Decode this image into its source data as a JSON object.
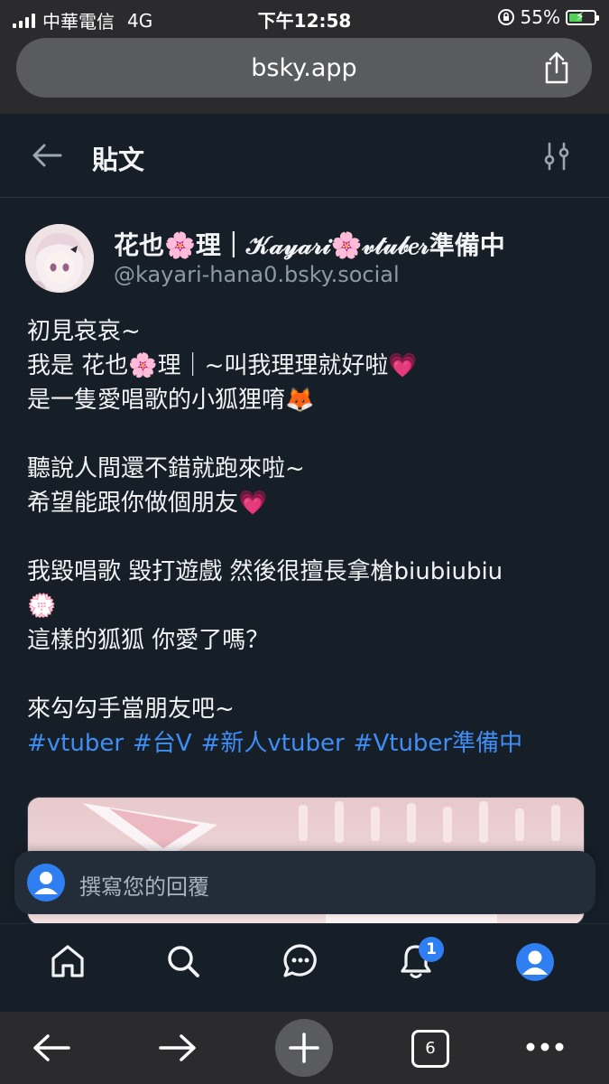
{
  "status_bar": {
    "carrier": "中華電信",
    "network": "4G",
    "time": "下午12:58",
    "battery": "55%",
    "battery_level": 0.55
  },
  "browser": {
    "url": "bsky.app",
    "tab_count": "6"
  },
  "header": {
    "title": "貼文"
  },
  "post": {
    "display_name": "花也🌸理｜𝒦𝒶𝓎𝒶𝓇𝒾🌸𝓋𝓉𝓊𝒷𝑒𝓇準備中",
    "handle": "@kayari-hana0.bsky.social",
    "lines": [
      "初見哀哀~",
      "我是 花也🌸理｜~叫我理理就好啦💗",
      "是一隻愛唱歌的小狐狸唷🦊",
      "",
      "聽說人間還不錯就跑來啦~",
      "希望能跟你做個朋友💗",
      "",
      "我毀唱歌 毀打遊戲 然後很擅長拿槍biubiubiu",
      "💮",
      "這樣的狐狐 你愛了嗎？",
      "",
      "來勾勾手當朋友吧~"
    ],
    "hashtags": [
      "#vtuber",
      "#台V",
      "#新人vtuber",
      "#Vtuber準備中"
    ]
  },
  "reply": {
    "placeholder": "撰寫您的回覆"
  },
  "nav": {
    "notification_count": "1"
  },
  "icons": {
    "share": "share-icon",
    "back": "back-arrow-icon",
    "filter": "sliders-icon",
    "home": "home-icon",
    "search": "search-icon",
    "chat": "chat-icon",
    "notifications": "bell-icon",
    "profile": "profile-icon",
    "browser_back": "arrow-left-icon",
    "browser_forward": "arrow-right-icon",
    "new_tab": "plus-icon",
    "tabs": "tabs-icon",
    "more": "more-icon"
  },
  "colors": {
    "background": "#161e27",
    "link": "#3f8ef5",
    "accent": "#2f7ff2",
    "browser_chrome": "#2b2b2d"
  }
}
